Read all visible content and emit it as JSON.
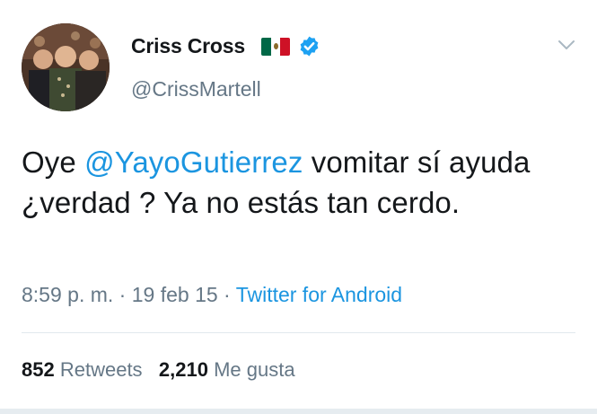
{
  "user": {
    "display_name": "Criss Cross",
    "handle": "@CrissMartell",
    "flag_icon": "mexico-flag-icon",
    "verified_icon": "verified-badge-icon"
  },
  "tweet": {
    "text_before": "Oye ",
    "mention": "@YayoGutierrez",
    "text_after": " vomitar sí ayuda ¿verdad ? Ya no estás tan cerdo."
  },
  "meta": {
    "time": "8:59 p. m.",
    "separator_1": " · ",
    "date": "19 feb 15",
    "separator_2": " · ",
    "source": "Twitter for Android"
  },
  "stats": {
    "retweets_count": "852",
    "retweets_label": "Retweets",
    "likes_count": "2,210",
    "likes_label": "Me gusta"
  },
  "colors": {
    "link": "#1b95e0",
    "secondary_text": "#657786",
    "primary_text": "#14171a",
    "divider": "#e1e8ed",
    "flag_green": "#006847",
    "flag_white": "#ffffff",
    "flag_red": "#ce1126"
  }
}
